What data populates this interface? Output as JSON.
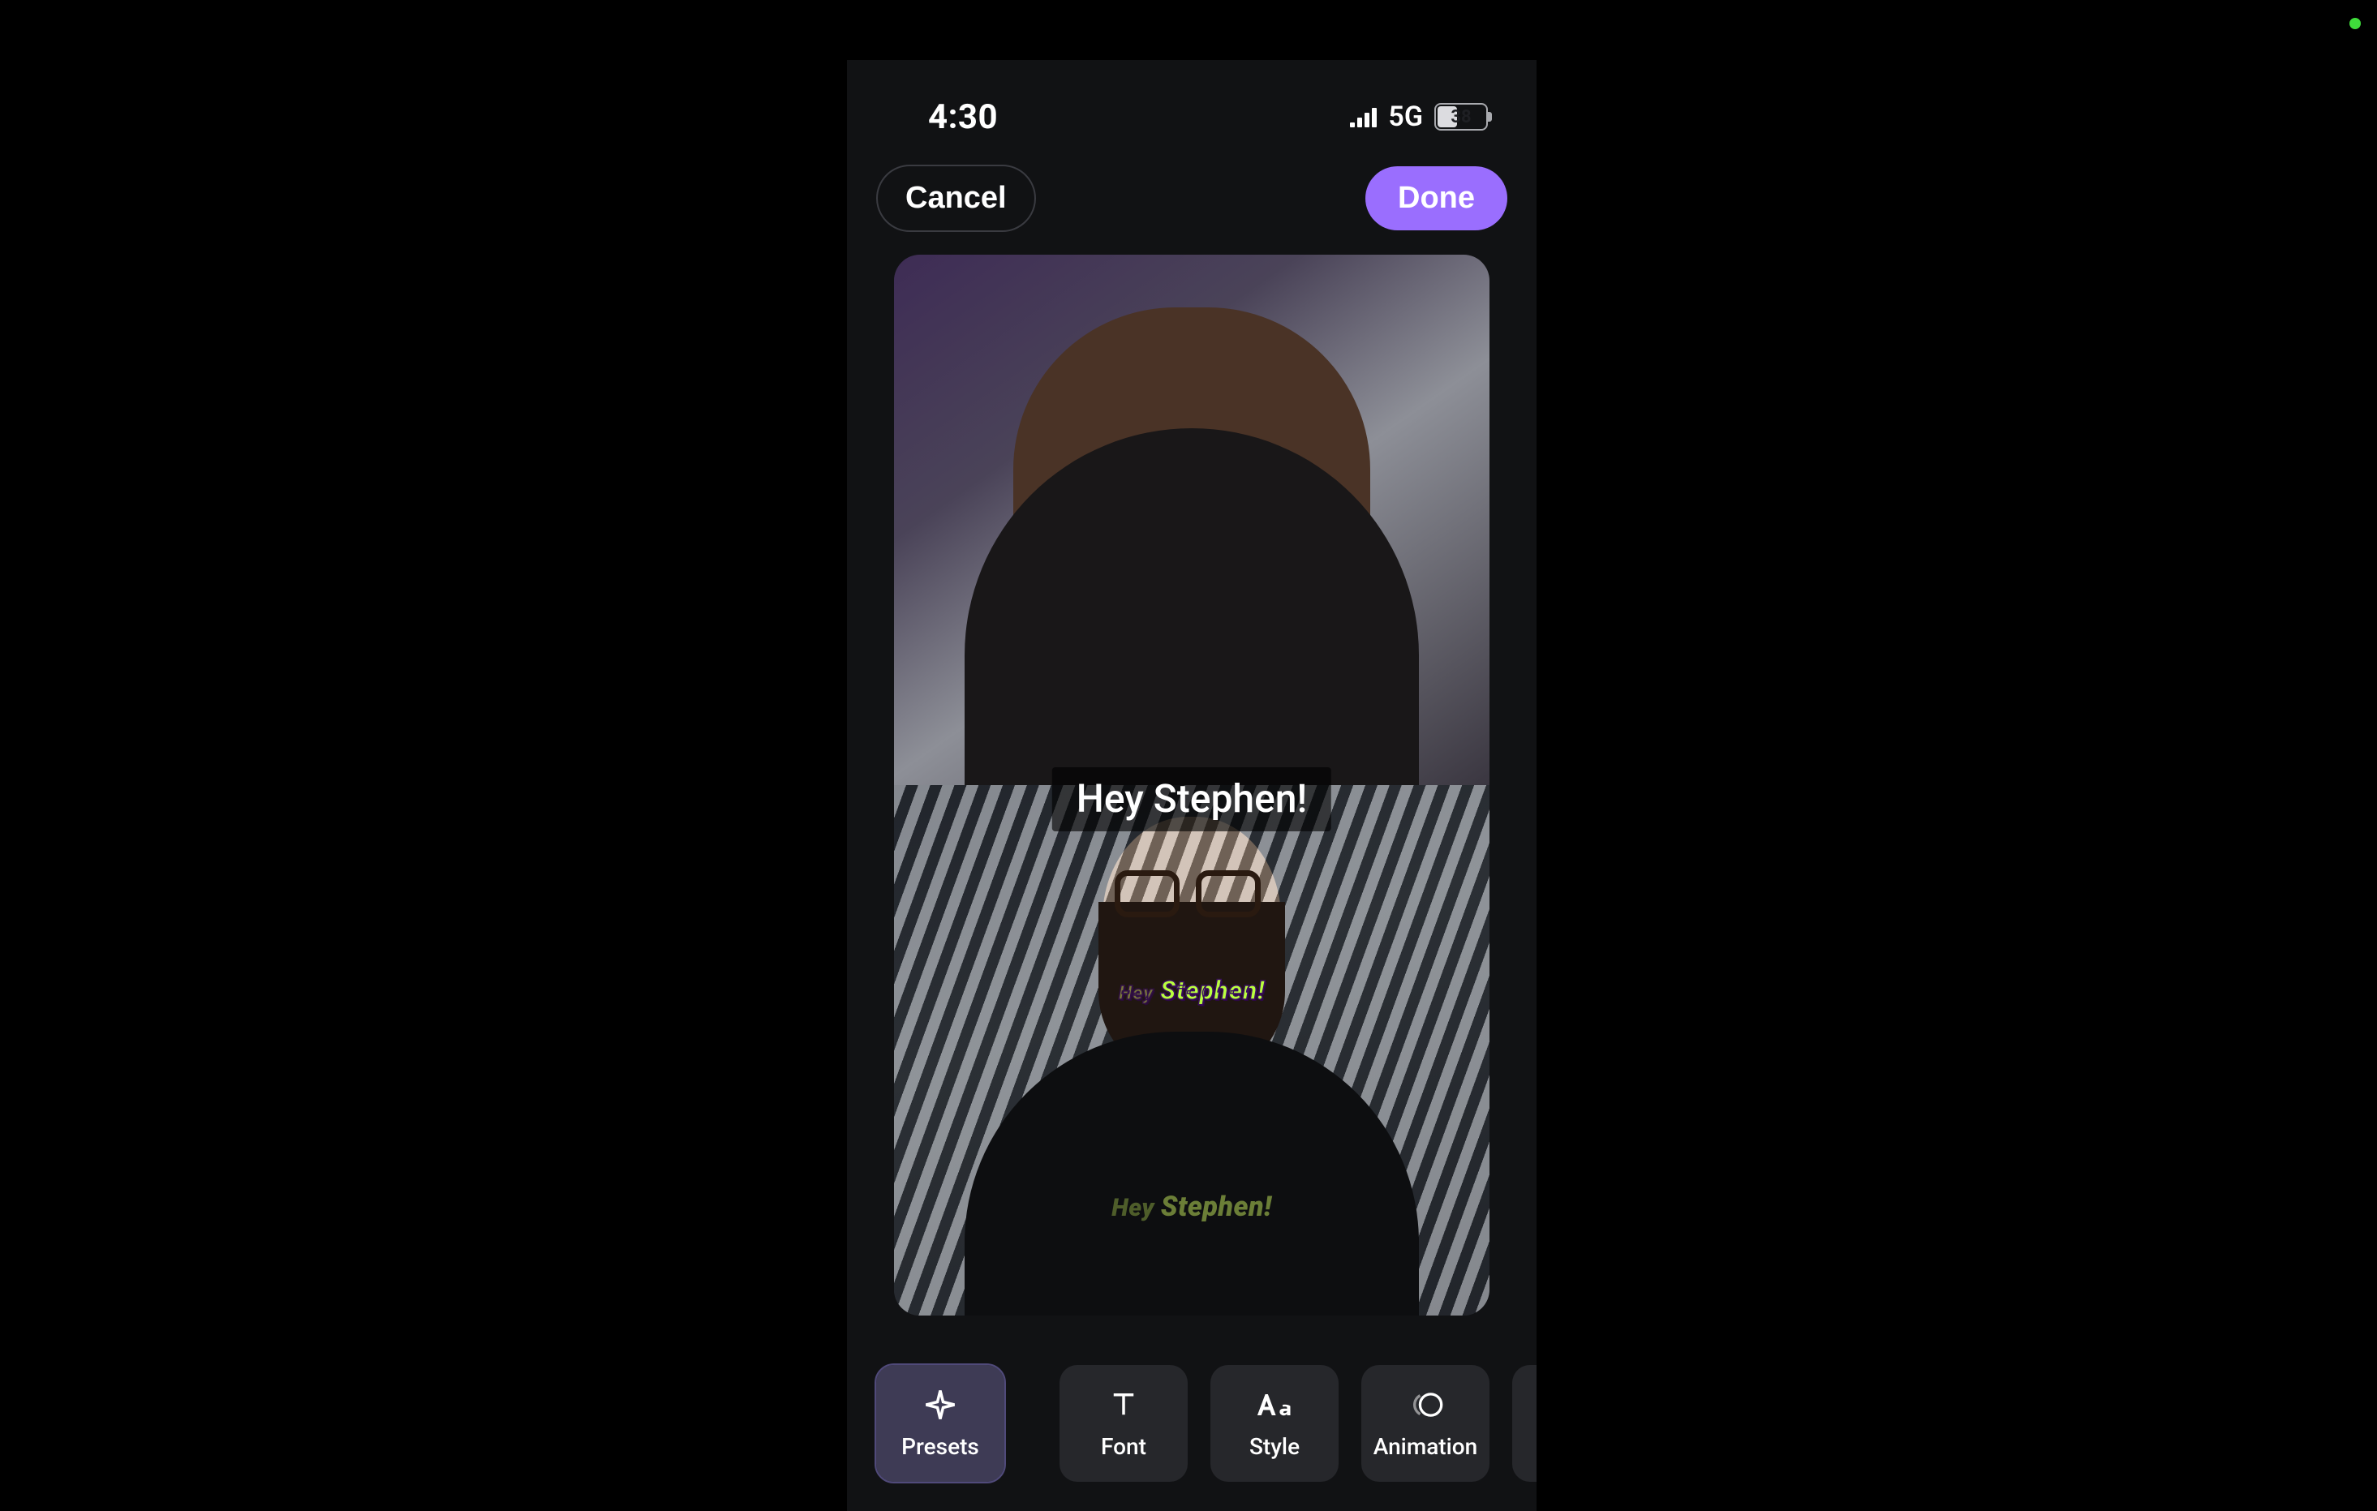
{
  "status": {
    "time": "4:30",
    "network": "5G",
    "battery_pct": "38"
  },
  "nav": {
    "cancel": "Cancel",
    "done": "Done"
  },
  "preview": {
    "caption_main": "Hey Stephen!",
    "caption_style2_small": "Hey",
    "caption_style2_big": "Stephen!",
    "caption_style3_small": "Hey",
    "caption_style3_big": "Stephen!"
  },
  "toolbar": {
    "presets": "Presets",
    "font": "Font",
    "style": "Style",
    "animation": "Animation"
  },
  "colors": {
    "accent": "#9a6efe",
    "tool_bg": "#26272b",
    "tool_selected_bg": "#3e3b55"
  }
}
